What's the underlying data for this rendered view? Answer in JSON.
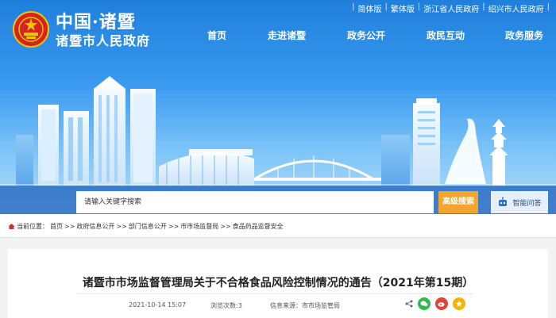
{
  "header": {
    "title": "中国·诸暨",
    "subtitle": "诸暨市人民政府"
  },
  "toplinks": [
    "简体版",
    "繁体版",
    "浙江省人民政府",
    "绍兴市人民政府"
  ],
  "nav": [
    "首页",
    "走进诸暨",
    "政务公开",
    "政民互动",
    "政务服务"
  ],
  "search": {
    "placeholder": "请输入关键字搜索",
    "button": "高级搜索",
    "qa": "智能问答"
  },
  "breadcrumb": {
    "prefix": "当前位置：",
    "items": [
      "首页",
      "政府信息公开",
      "部门信息公开",
      "市市场监督局",
      "食品药品监督安全"
    ]
  },
  "article": {
    "title": "诸暨市市场监督管理局关于不合格食品风险控制情况的通告（2021年第15期）",
    "date": "2021-10-14 15:07",
    "views": "浏览次数:3",
    "source": "信息来源：市市场监管局"
  },
  "colors": {
    "banner_blue": "#1f7fdc",
    "search_orange": "#f2a630",
    "wechat_green": "#2dbb4f",
    "weibo_red": "#e0423c",
    "qzone_yellow": "#f5b400"
  },
  "icons": [
    "emblem-icon",
    "robot-icon",
    "share-icon",
    "wechat-icon",
    "weibo-icon",
    "qzone-icon"
  ]
}
